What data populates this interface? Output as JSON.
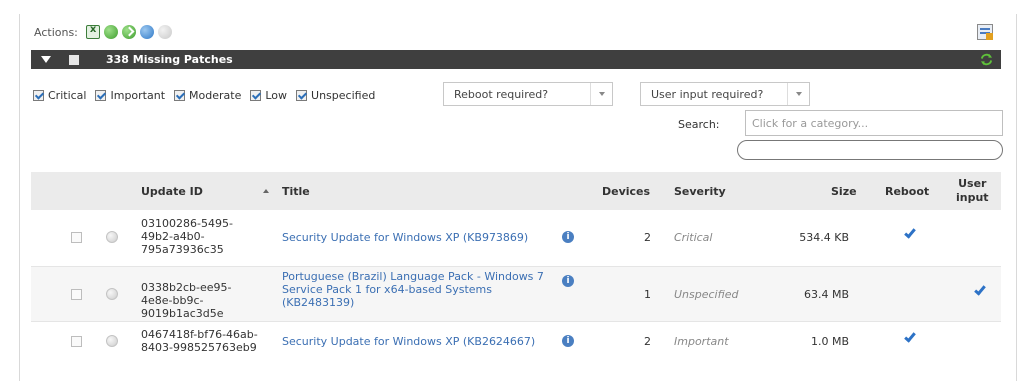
{
  "actions": {
    "label": "Actions:",
    "icons": [
      "excel-export-icon",
      "green-circle-icon",
      "green-check-circle-icon",
      "blue-circle-icon",
      "grey-circle-icon"
    ]
  },
  "header_bar": {
    "count_label": "338 Missing Patches"
  },
  "filters": {
    "checkboxes": [
      {
        "label": "Critical",
        "checked": true
      },
      {
        "label": "Important",
        "checked": true
      },
      {
        "label": "Moderate",
        "checked": true
      },
      {
        "label": "Low",
        "checked": true
      },
      {
        "label": "Unspecified",
        "checked": true
      }
    ],
    "reboot_select": "Reboot required?",
    "user_input_select": "User input required?",
    "search_label": "Search:",
    "search_placeholder": "Click for a category..."
  },
  "table": {
    "columns": {
      "update_id": "Update ID",
      "title": "Title",
      "devices": "Devices",
      "severity": "Severity",
      "size": "Size",
      "reboot": "Reboot",
      "user_input": "User input"
    },
    "rows": [
      {
        "update_id": "03100286-5495-49b2-a4b0-795a73936c35",
        "title": "Security Update for Windows XP (KB973869)",
        "devices": "2",
        "severity": "Critical",
        "size": "534.4 KB",
        "reboot": true,
        "user_input": false
      },
      {
        "update_id": "0338b2cb-ee95-4e8e-bb9c-9019b1ac3d5e",
        "title": "Portuguese (Brazil) Language Pack - Windows 7 Service Pack 1 for x64-based Systems (KB2483139)",
        "devices": "1",
        "severity": "Unspecified",
        "size": "63.4 MB",
        "reboot": false,
        "user_input": true
      },
      {
        "update_id": "0467418f-bf76-46ab-8403-998525763eb9",
        "title": "Security Update for Windows XP (KB2624667)",
        "devices": "2",
        "severity": "Important",
        "size": "1.0 MB",
        "reboot": true,
        "user_input": false
      }
    ]
  },
  "colors": {
    "header_bar": "#3f3f3f",
    "link": "#3b6fb3",
    "check": "#2d72c6"
  }
}
